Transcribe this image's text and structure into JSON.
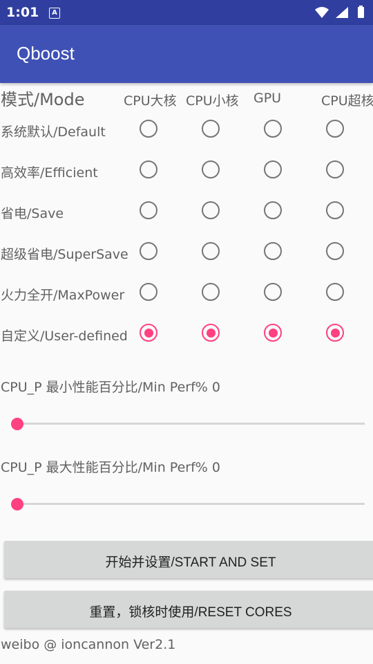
{
  "status_bar": {
    "time": "1:01",
    "notification_icon": "A"
  },
  "app_bar": {
    "title": "Qboost"
  },
  "mode_header": {
    "label": "模式/Mode",
    "columns": [
      "CPU大核",
      "CPU小核",
      "GPU",
      "CPU超核"
    ]
  },
  "modes": [
    {
      "label": "系统默认/Default",
      "selected": [
        false,
        false,
        false,
        false
      ]
    },
    {
      "label": "高效率/Efficient",
      "selected": [
        false,
        false,
        false,
        false
      ]
    },
    {
      "label": "省电/Save",
      "selected": [
        false,
        false,
        false,
        false
      ]
    },
    {
      "label": "超级省电/SuperSave",
      "selected": [
        false,
        false,
        false,
        false
      ]
    },
    {
      "label": "火力全开/MaxPower",
      "selected": [
        false,
        false,
        false,
        false
      ]
    },
    {
      "label": "自定义/User-defined",
      "selected": [
        true,
        true,
        true,
        true
      ]
    }
  ],
  "sliders": [
    {
      "label": "CPU_P 最小性能百分比/Min Perf% 0",
      "value_percent": 0
    },
    {
      "label": "CPU_P 最大性能百分比/Min Perf% 0",
      "value_percent": 0
    }
  ],
  "buttons": {
    "start_label": "开始并设置/START AND SET",
    "reset_label": "重置，锁核时使用/RESET CORES"
  },
  "footer": "weibo @ ioncannon Ver2.1",
  "colors": {
    "status_bar": "#303f9f",
    "app_bar": "#3f51b5",
    "accent": "#ff4081"
  }
}
